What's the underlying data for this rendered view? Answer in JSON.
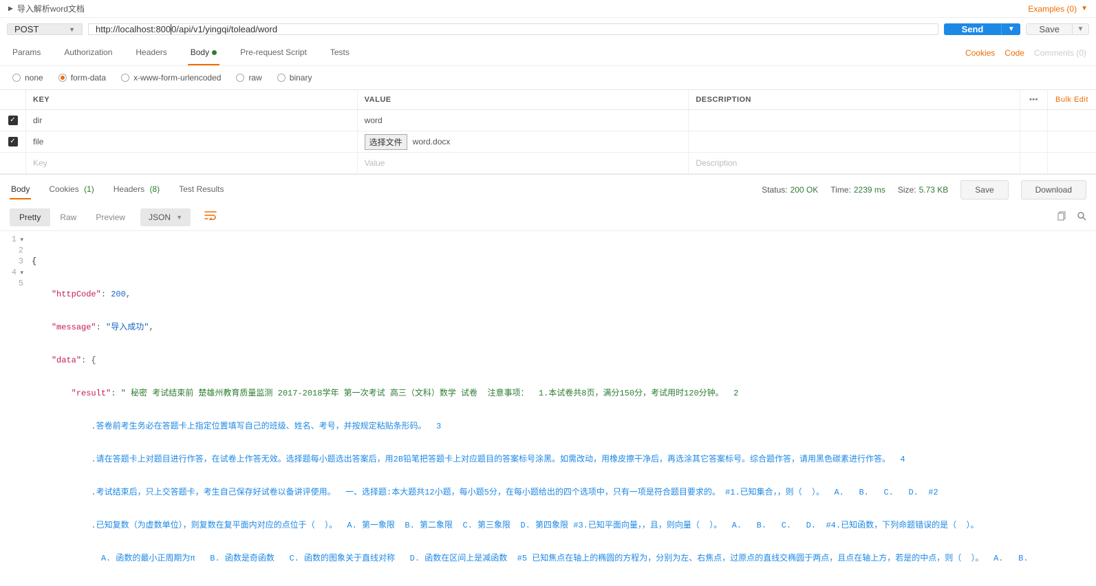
{
  "header": {
    "title": "导入解析word文档",
    "examples_label": "Examples (0)"
  },
  "request": {
    "method": "POST",
    "url_before": "http://localhost:800",
    "url_after": "0/api/v1/yingqi/tolead/word",
    "send_label": "Send",
    "save_label": "Save"
  },
  "req_tabs": {
    "params": "Params",
    "authorization": "Authorization",
    "headers": "Headers",
    "body": "Body",
    "prerequest": "Pre-request Script",
    "tests": "Tests",
    "cookies": "Cookies",
    "code": "Code",
    "comments": "Comments (0)"
  },
  "body_modes": {
    "none": "none",
    "formdata": "form-data",
    "urlencoded": "x-www-form-urlencoded",
    "raw": "raw",
    "binary": "binary"
  },
  "kv": {
    "key_header": "KEY",
    "value_header": "VALUE",
    "desc_header": "DESCRIPTION",
    "more": "•••",
    "bulk_edit": "Bulk Edit",
    "rows": [
      {
        "key": "dir",
        "value": "word"
      },
      {
        "key": "file",
        "choose": "选择文件",
        "filename": "word.docx"
      }
    ],
    "placeholder": {
      "key": "Key",
      "value": "Value",
      "desc": "Description"
    }
  },
  "response": {
    "tabs": {
      "body": "Body",
      "cookies": "Cookies",
      "cookies_count": "(1)",
      "headers": "Headers",
      "headers_count": "(8)",
      "tests": "Test Results"
    },
    "status_label": "Status:",
    "status_value": "200 OK",
    "time_label": "Time:",
    "time_value": "2239 ms",
    "size_label": "Size:",
    "size_value": "5.73 KB",
    "save_label": "Save",
    "download_label": "Download",
    "toolbar": {
      "pretty": "Pretty",
      "raw": "Raw",
      "preview": "Preview",
      "lang": "JSON"
    }
  },
  "json_body": {
    "l1": "{",
    "l2k": "\"httpCode\"",
    "l2c": ": ",
    "l2v": "200",
    "l2e": ",",
    "l3k": "\"message\"",
    "l3c": ": ",
    "l3v": "\"导入成功\"",
    "l3e": ",",
    "l4k": "\"data\"",
    "l4c": ": {",
    "l5k": "\"result\"",
    "l5c": ": ",
    "l5v": "\" 秘密 考试结束前 楚雄州教育质量监测 2017-2018学年 第一次考试 高三（文科）数学 试卷  注意事项：  1.本试卷共8页，满分150分，考试用时120分钟。  2",
    "l6": ".答卷前考生务必在答题卡上指定位置填写自己的班级、姓名、考号，并按规定粘贴条形码。  3",
    "l7": ".请在答题卡上对题目进行作答，在试卷上作答无效。选择题每小题选出答案后，用2B铅笔把答题卡上对应题目的答案标号涂黑。如需改动，用橡皮擦干净后，再选涂其它答案标号。综合题作答，请用黑色碳素进行作答。  4",
    "l8": ".考试结束后，只上交答题卡，考生自己保存好试卷以备讲评使用。  一、选择题:本大题共12小题，每小题5分，在每小题给出的四个选项中，只有一项是符合题目要求的。 #1.已知集合，，则（  ）。  A.   B.   C.   D.  #2",
    "l9": ".已知复数（为虚数单位），则复数在复平面内对应的点位于（  ）。  A. 第一象限  B. 第二象限  C. 第三象限  D. 第四象限 #3.已知平面向量，，且，则向量（  ）。  A.   B.   C.   D.  #4.已知函数，下列命题错误的是（  ）。",
    "l10": "  A. 函数的最小正周期为π   B. 函数是奇函数   C. 函数的图象关于直线对称   D. 函数在区间上是减函数  #5 已知焦点在轴上的椭圆的方程为，分别为左、右焦点，过原点的直线交椭圆于两点，且点在轴上方，若是的中点，则（  ）。  A.   B."
  }
}
